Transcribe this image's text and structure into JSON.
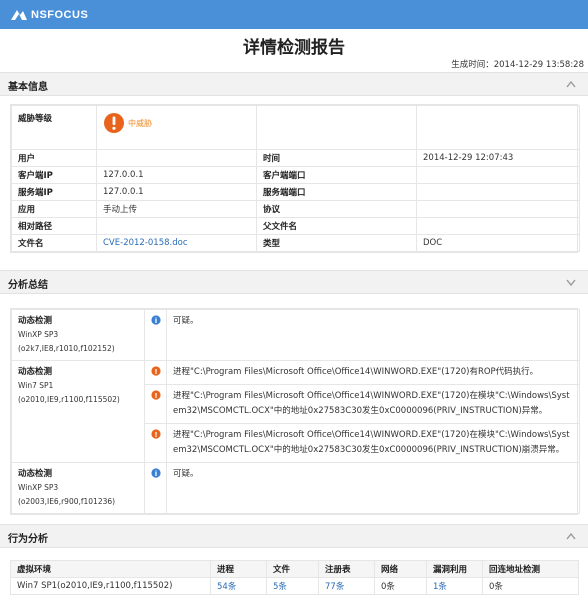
{
  "brand": "NSFOCUS",
  "title": "详情检测报告",
  "gen_time_label": "生成时间：",
  "gen_time": "2014-12-29 13:58:28",
  "sections": {
    "basic": "基本信息",
    "analysis": "分析总结",
    "behavior": "行为分析"
  },
  "basic_info": {
    "threat_label": "威胁等级",
    "threat_value": "中威胁",
    "threat_color": "#f08a24",
    "rows": [
      {
        "l1": "用户",
        "v1": "",
        "l2": "时间",
        "v2": "2014-12-29 12:07:43"
      },
      {
        "l1": "客户端IP",
        "v1": "127.0.0.1",
        "l2": "客户端端口",
        "v2": ""
      },
      {
        "l1": "服务端IP",
        "v1": "127.0.0.1",
        "l2": "服务端端口",
        "v2": ""
      },
      {
        "l1": "应用",
        "v1": "手动上传",
        "l2": "协议",
        "v2": ""
      },
      {
        "l1": "相对路径",
        "v1": "",
        "l2": "父文件名",
        "v2": ""
      },
      {
        "l1": "文件名",
        "v1": "CVE-2012-0158.doc",
        "l2": "类型",
        "v2": "DOC"
      }
    ]
  },
  "analysis": {
    "groups": [
      {
        "title": "动态检测",
        "os": "WinXP SP3",
        "cfg": "(o2k7,IE8,r1010,f102152)",
        "items": [
          {
            "icon": "info-icon",
            "text": "可疑。"
          }
        ]
      },
      {
        "title": "动态检测",
        "os": "Win7 SP1",
        "cfg": "(o2010,IE9,r1100,f115502)",
        "items": [
          {
            "icon": "warning-icon",
            "text": "进程\"C:\\Program Files\\Microsoft Office\\Office14\\WINWORD.EXE\"(1720)有ROP代码执行。"
          },
          {
            "icon": "warning-icon",
            "text": "进程\"C:\\Program Files\\Microsoft Office\\Office14\\WINWORD.EXE\"(1720)在模块\"C:\\Windows\\System32\\MSCOMCTL.OCX\"中的地址0x27583C30发生0xC0000096(PRIV_INSTRUCTION)异常。"
          },
          {
            "icon": "warning-icon",
            "text": "进程\"C:\\Program Files\\Microsoft Office\\Office14\\WINWORD.EXE\"(1720)在模块\"C:\\Windows\\System32\\MSCOMCTL.OCX\"中的地址0x27583C30发生0xC0000096(PRIV_INSTRUCTION)崩溃异常。"
          }
        ]
      },
      {
        "title": "动态检测",
        "os": "WinXP SP3",
        "cfg": "(o2003,IE6,r900,f101236)",
        "items": [
          {
            "icon": "info-icon",
            "text": "可疑。"
          }
        ]
      }
    ]
  },
  "behavior": {
    "headers": [
      "虚拟环境",
      "进程",
      "文件",
      "注册表",
      "网络",
      "漏洞利用",
      "回连地址检测"
    ],
    "rows": [
      [
        "Win7 SP1(o2010,IE9,r1100,f115502)",
        "54条",
        "5条",
        "77条",
        "0条",
        "1条",
        "0条"
      ]
    ]
  },
  "colors": {
    "topbar": "#4a90d9",
    "link": "#2a6bb5",
    "info_icon": "#3b7fd0",
    "warning_icon": "#e8641c"
  }
}
